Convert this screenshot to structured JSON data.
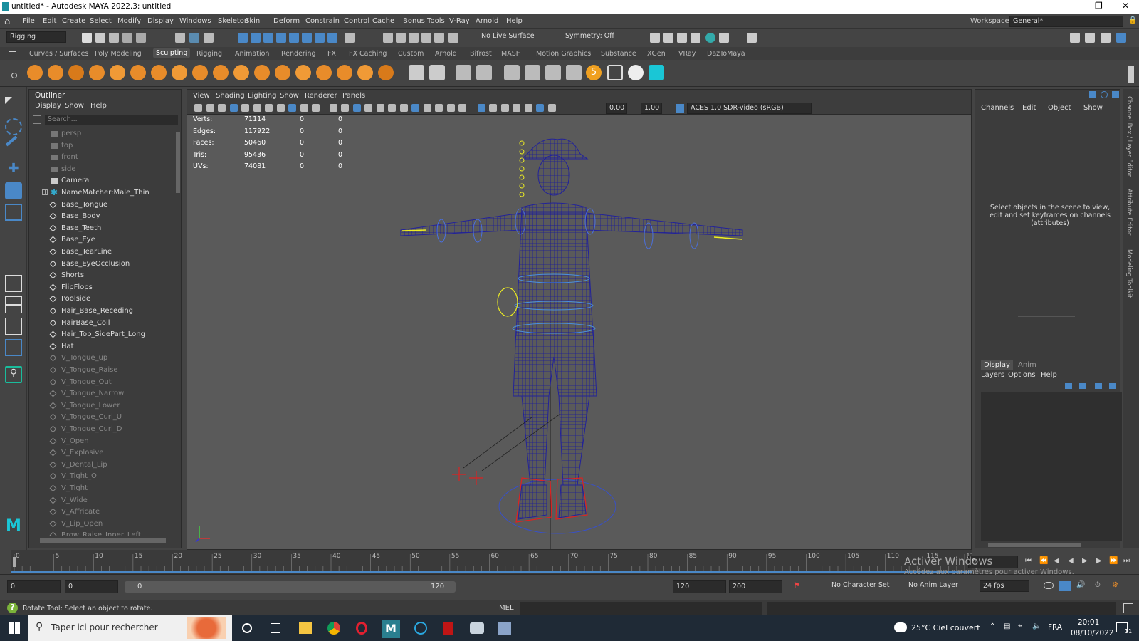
{
  "window": {
    "title": "untitled* - Autodesk MAYA 2022.3: untitled"
  },
  "menu": {
    "items": [
      "File",
      "Edit",
      "Create",
      "Select",
      "Modify",
      "Display",
      "Windows",
      "Skeleton",
      "Skin",
      "Deform",
      "Constrain",
      "Control",
      "Cache",
      "Bonus Tools",
      "V-Ray",
      "Arnold",
      "Help"
    ],
    "workspace_label": "Workspace:",
    "workspace_value": "General*"
  },
  "statusline": {
    "menuset": "Rigging",
    "live_surface": "No Live Surface",
    "symmetry": "Symmetry: Off"
  },
  "shelf": {
    "tabs": [
      "Curves / Surfaces",
      "Poly Modeling",
      "Sculpting",
      "Rigging",
      "Animation",
      "Rendering",
      "FX",
      "FX Caching",
      "Custom",
      "Arnold",
      "Bifrost",
      "MASH",
      "Motion Graphics",
      "Substance",
      "XGen",
      "VRay",
      "DazToMaya"
    ],
    "active_tab": "Sculpting",
    "badge_number": "5"
  },
  "outliner": {
    "title": "Outliner",
    "menus": [
      "Display",
      "Show",
      "Help"
    ],
    "search_placeholder": "Search...",
    "items": [
      {
        "label": "persp",
        "type": "camera",
        "dim": true
      },
      {
        "label": "top",
        "type": "camera",
        "dim": true
      },
      {
        "label": "front",
        "type": "camera",
        "dim": true
      },
      {
        "label": "side",
        "type": "camera",
        "dim": true
      },
      {
        "label": "Camera",
        "type": "camera",
        "dim": false
      },
      {
        "label": "NameMatcher:Male_Thin",
        "type": "joint",
        "dim": false
      },
      {
        "label": "Base_Tongue",
        "type": "mesh",
        "dim": false
      },
      {
        "label": "Base_Body",
        "type": "mesh",
        "dim": false
      },
      {
        "label": "Base_Teeth",
        "type": "mesh",
        "dim": false
      },
      {
        "label": "Base_Eye",
        "type": "mesh",
        "dim": false
      },
      {
        "label": "Base_TearLine",
        "type": "mesh",
        "dim": false
      },
      {
        "label": "Base_EyeOcclusion",
        "type": "mesh",
        "dim": false
      },
      {
        "label": "Shorts",
        "type": "mesh",
        "dim": false
      },
      {
        "label": "FlipFlops",
        "type": "mesh",
        "dim": false
      },
      {
        "label": "Poolside",
        "type": "mesh",
        "dim": false
      },
      {
        "label": "Hair_Base_Receding",
        "type": "mesh",
        "dim": false
      },
      {
        "label": "HairBase_Coil",
        "type": "mesh",
        "dim": false
      },
      {
        "label": "Hair_Top_SidePart_Long",
        "type": "mesh",
        "dim": false
      },
      {
        "label": "Hat",
        "type": "mesh",
        "dim": false
      },
      {
        "label": "V_Tongue_up",
        "type": "mesh",
        "dim": true
      },
      {
        "label": "V_Tongue_Raise",
        "type": "mesh",
        "dim": true
      },
      {
        "label": "V_Tongue_Out",
        "type": "mesh",
        "dim": true
      },
      {
        "label": "V_Tongue_Narrow",
        "type": "mesh",
        "dim": true
      },
      {
        "label": "V_Tongue_Lower",
        "type": "mesh",
        "dim": true
      },
      {
        "label": "V_Tongue_Curl_U",
        "type": "mesh",
        "dim": true
      },
      {
        "label": "V_Tongue_Curl_D",
        "type": "mesh",
        "dim": true
      },
      {
        "label": "V_Open",
        "type": "mesh",
        "dim": true
      },
      {
        "label": "V_Explosive",
        "type": "mesh",
        "dim": true
      },
      {
        "label": "V_Dental_Lip",
        "type": "mesh",
        "dim": true
      },
      {
        "label": "V_Tight_O",
        "type": "mesh",
        "dim": true
      },
      {
        "label": "V_Tight",
        "type": "mesh",
        "dim": true
      },
      {
        "label": "V_Wide",
        "type": "mesh",
        "dim": true
      },
      {
        "label": "V_Affricate",
        "type": "mesh",
        "dim": true
      },
      {
        "label": "V_Lip_Open",
        "type": "mesh",
        "dim": true
      },
      {
        "label": "Brow_Raise_Inner_Left",
        "type": "mesh",
        "dim": true
      }
    ]
  },
  "viewport": {
    "menus": [
      "View",
      "Shading",
      "Lighting",
      "Show",
      "Renderer",
      "Panels"
    ],
    "exposure": "0.00",
    "gamma": "1.00",
    "color_space": "ACES 1.0 SDR-video (sRGB)",
    "hud": [
      {
        "label": "Verts:",
        "v1": "71114",
        "v2": "0",
        "v3": "0"
      },
      {
        "label": "Edges:",
        "v1": "117922",
        "v2": "0",
        "v3": "0"
      },
      {
        "label": "Faces:",
        "v1": "50460",
        "v2": "0",
        "v3": "0"
      },
      {
        "label": "Tris:",
        "v1": "95436",
        "v2": "0",
        "v3": "0"
      },
      {
        "label": "UVs:",
        "v1": "74081",
        "v2": "0",
        "v3": "0"
      }
    ]
  },
  "channelbox": {
    "menus": [
      "Channels",
      "Edit",
      "Object",
      "Show"
    ],
    "message": "Select objects in the scene to view, edit and set keyframes on channels (attributes)",
    "layer_tabs": [
      "Display",
      "Anim"
    ],
    "layer_menus": [
      "Layers",
      "Options",
      "Help"
    ],
    "side_tabs": [
      "Channel Box / Layer Editor",
      "Attribute Editor",
      "Modeling Toolkit"
    ]
  },
  "timeline": {
    "ticks": [
      "0",
      "5",
      "10",
      "15",
      "20",
      "25",
      "30",
      "35",
      "40",
      "45",
      "50",
      "55",
      "60",
      "65",
      "70",
      "75",
      "80",
      "85",
      "90",
      "95",
      "100",
      "105",
      "110",
      "115",
      "120"
    ],
    "current_frame": "0"
  },
  "range": {
    "start": "0",
    "anim_start": "0",
    "slider_start": "0",
    "slider_end": "120",
    "end": "120",
    "anim_end": "200",
    "character_set": "No Character Set",
    "anim_layer": "No Anim Layer",
    "fps": "24 fps"
  },
  "watermark": {
    "line1": "Activer Windows",
    "line2": "Accédez aux paramètres pour activer Windows."
  },
  "helpline": {
    "text": "Rotate Tool: Select an object to rotate.",
    "mel": "MEL"
  },
  "taskbar": {
    "search": "Taper ici pour rechercher",
    "weather": "25°C  Ciel couvert",
    "lang": "FRA",
    "time": "20:01",
    "date": "08/10/2022",
    "notif": "11"
  }
}
